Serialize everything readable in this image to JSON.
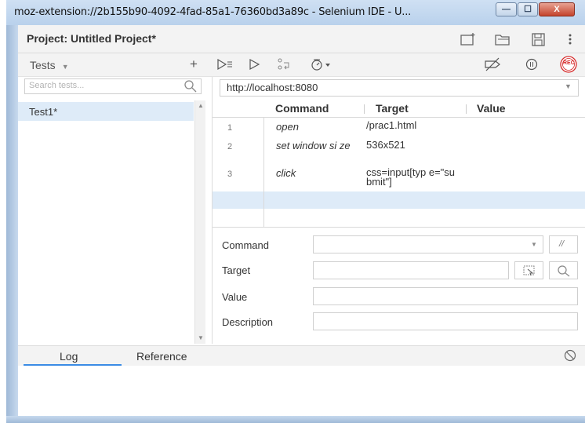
{
  "window": {
    "title": "moz-extension://2b155b90-4092-4fad-85a1-76360bd3a89c - Selenium IDE - U...",
    "min_glyph": "—",
    "max_glyph": "☐",
    "close_glyph": "X"
  },
  "project": {
    "title": "Project:  Untitled Project*"
  },
  "tests_panel": {
    "title": "Tests",
    "add_label": "+",
    "search_placeholder": "Search tests...",
    "tests": [
      "Test1*"
    ]
  },
  "toolbar": {
    "rec_label": "REC"
  },
  "url": {
    "value": "http://localhost:8080"
  },
  "table": {
    "headers": [
      "Command",
      "Target",
      "Value"
    ],
    "rows": [
      {
        "num": "1",
        "command": "open",
        "target": "/prac1.html",
        "value": ""
      },
      {
        "num": "2",
        "command": "set window si ze",
        "target": "536x521",
        "value": ""
      },
      {
        "num": "3",
        "command": "click",
        "target": "css=input[typ e=\"submit\"]",
        "value": ""
      }
    ]
  },
  "form": {
    "command_label": "Command",
    "target_label": "Target",
    "value_label": "Value",
    "description_label": "Description",
    "comment_glyph": "//"
  },
  "bottom": {
    "log_label": "Log",
    "reference_label": "Reference"
  },
  "colors": {
    "accent": "#3b8ce5",
    "selected_row": "#deebf8",
    "rec": "#d62828"
  }
}
